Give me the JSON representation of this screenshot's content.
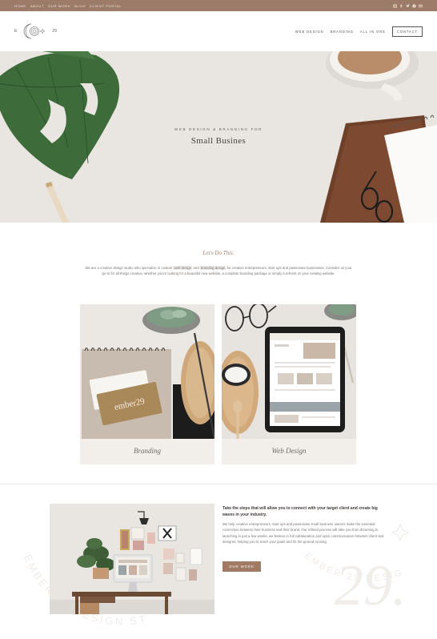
{
  "topbar": {
    "nav": [
      "HOME",
      "ABOUT",
      "OUR WORK",
      "BLOG",
      "CLIENT PORTAL"
    ],
    "social_icons": [
      "instagram-icon",
      "facebook-icon",
      "twitter-icon",
      "pinterest-icon",
      "email-icon"
    ]
  },
  "header": {
    "logo_left": "E",
    "logo_right": "29",
    "nav": [
      "WEB DESIGN",
      "BRANDING",
      "ALL IN ONE"
    ],
    "contact_label": "CONTACT"
  },
  "hero": {
    "overline": "WEB DESIGN & BRANDING FOR",
    "title": "Small Busines"
  },
  "intro": {
    "title": "Let's Do This.",
    "text_1": "We are a creative design studio who specialize in custom ",
    "hl_1": "web design",
    "text_2": " and ",
    "hl_2": "branding design",
    "text_3": " for creative entrepreneurs, start ups and passionate businesses. Consider us your go-to for all things creative, whether you're looking for a beautiful new website, a complete branding package or simply a refresh on your existing website."
  },
  "cards": [
    {
      "label": "Branding",
      "card_text": "ember29"
    },
    {
      "label": "Web Design"
    }
  ],
  "cta": {
    "title": "Take the steps that will allow you to connect with your target client and create big waves in your industry.",
    "body": "We help creative entrepreneurs, start ups and passionate small business owners make the essential connection between their business and their brand. Our refined process will take you from dreaming to launching in just a few weeks, we believe in full collaboration and open communication between client and designer, helping you to reach your goals and hit the ground running.",
    "button_label": "OUR WORK",
    "watermark_text": "EMBER 29 DESIGN STUDIO",
    "watermark_num": "29."
  },
  "colors": {
    "topbar": "#9c7b68",
    "accent": "#a07a63",
    "hero_bg": "#e8e4df",
    "card_bg": "#f2efeb"
  }
}
